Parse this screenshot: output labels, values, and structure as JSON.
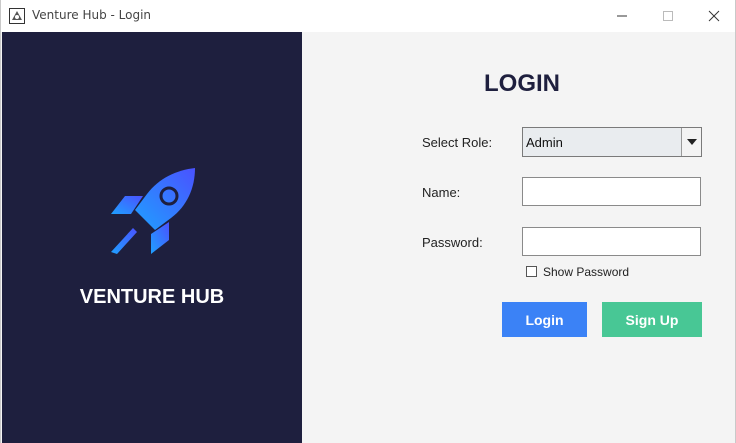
{
  "window": {
    "title": "Venture Hub - Login",
    "controls": [
      "minimize",
      "maximize",
      "close"
    ]
  },
  "brand": {
    "name": "VENTURE HUB",
    "logo_icon": "rocket-icon",
    "panel_color": "#1e1f3e"
  },
  "form": {
    "heading": "LOGIN",
    "role_label": "Select Role:",
    "role_value": "Admin",
    "name_label": "Name:",
    "name_value": "",
    "password_label": "Password:",
    "password_value": "",
    "show_password_label": "Show Password",
    "show_password_checked": false
  },
  "buttons": {
    "login": "Login",
    "signup": "Sign Up"
  },
  "colors": {
    "login_button": "#3b82f6",
    "signup_button": "#48c795",
    "heading": "#1e1f3e"
  }
}
